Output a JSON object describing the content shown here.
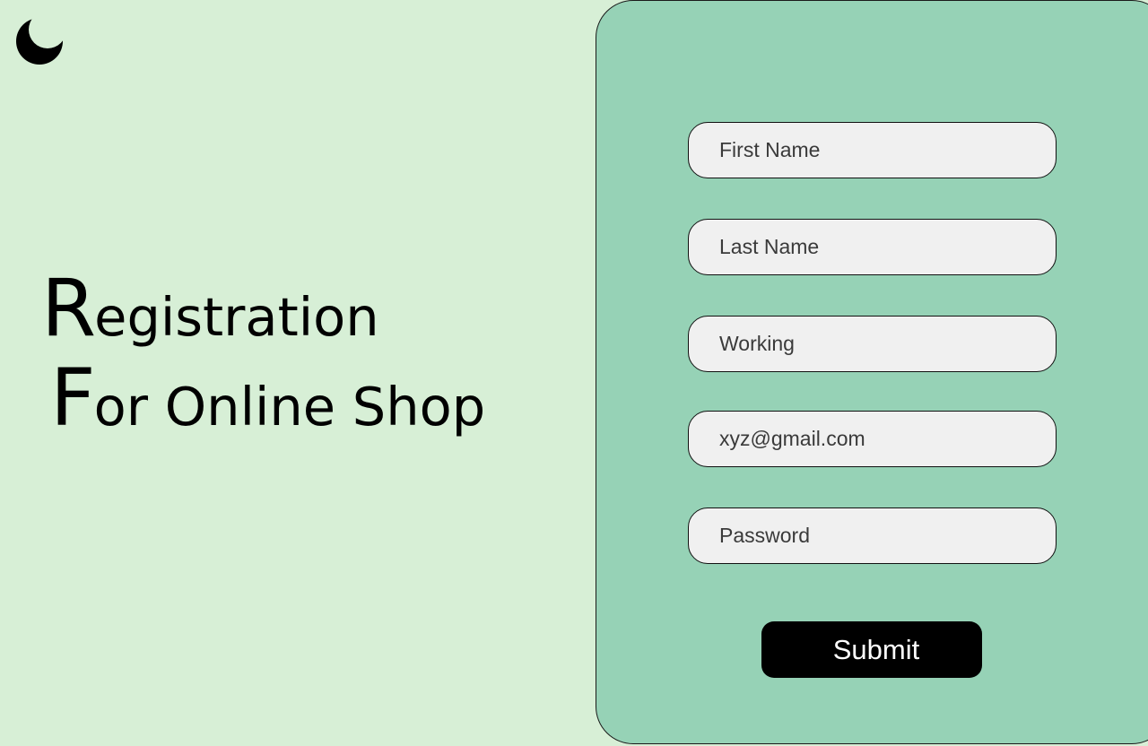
{
  "theme": {
    "background": "#d7efd6",
    "panel": "#96d2b6",
    "field_bg": "#f0f0f0",
    "button_bg": "#000000",
    "button_text": "#ffffff"
  },
  "toggle": {
    "icon": "moon-icon"
  },
  "heading": {
    "line1_initial": "R",
    "line1_rest": "egistration",
    "line2_initial": "F",
    "line2_rest": "or Online Shop"
  },
  "form": {
    "fields": [
      {
        "placeholder": "First Name",
        "value": ""
      },
      {
        "placeholder": "Last Name",
        "value": ""
      },
      {
        "placeholder": "Working",
        "value": ""
      },
      {
        "placeholder": "xyz@gmail.com",
        "value": ""
      },
      {
        "placeholder": "Password",
        "value": ""
      }
    ],
    "submit_label": "Submit"
  }
}
